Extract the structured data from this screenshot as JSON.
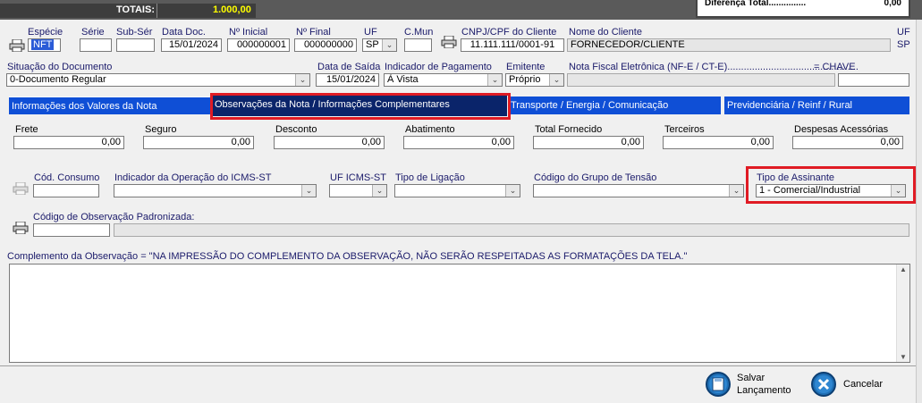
{
  "top": {
    "totais_label": "TOTAIS:",
    "totais_value": "1.000,00",
    "diferenca_label": "Diferença Total...............",
    "diferenca_value": "0,00"
  },
  "header": {
    "especie_label": "Espécie",
    "especie_value": "NFT",
    "serie_label": "Série",
    "serie_value": "",
    "subserie_label": "Sub-Sér",
    "subserie_value": "",
    "datadoc_label": "Data Doc.",
    "datadoc_value": "15/01/2024",
    "ninicial_label": "Nº Inicial",
    "ninicial_value": "000000001",
    "nfinal_label": "Nº Final",
    "nfinal_value": "000000000",
    "uf_label": "UF",
    "uf_value": "SP",
    "cmun_label": "C.Mun",
    "cmun_value": "",
    "cnpj_label": "CNPJ/CPF do Cliente",
    "cnpj_value": "11.111.111/0001-91",
    "nome_label": "Nome do Cliente",
    "nome_value": "FORNECEDOR/CLIENTE",
    "uf2_label": "UF",
    "uf2_value": "SP"
  },
  "row2": {
    "situacao_label": "Situação do Documento",
    "situacao_value": "0-Documento Regular",
    "datasaida_label": "Data de Saída",
    "datasaida_value": "15/01/2024",
    "indpag_label": "Indicador de Pagamento",
    "indpag_value": "À Vista",
    "emitente_label": "Emitente",
    "emitente_value": "Próprio",
    "nfe_label": "Nota Fiscal Eletrônica (NF-E / CT-E)................................................",
    "chave_label": "=  CHAVE",
    "nfe_value": "",
    "chave_value": ""
  },
  "tabs": [
    {
      "label": "Informações dos Valores da Nota"
    },
    {
      "label": "Observações da Nota / Informações Complementares"
    },
    {
      "label": "Transporte / Energia / Comunicação"
    },
    {
      "label": "Previdenciária / Reinf / Rural"
    }
  ],
  "values": [
    {
      "label": "Frete",
      "value": "0,00"
    },
    {
      "label": "Seguro",
      "value": "0,00"
    },
    {
      "label": "Desconto",
      "value": "0,00"
    },
    {
      "label": "Abatimento",
      "value": "0,00"
    },
    {
      "label": "Total Fornecido",
      "value": "0,00"
    },
    {
      "label": "Terceiros",
      "value": "0,00"
    },
    {
      "label": "Despesas Acessórias",
      "value": "0,00"
    }
  ],
  "energy": {
    "codconsumo_label": "Cód. Consumo",
    "codconsumo_value": "",
    "indop_label": "Indicador da Operação do ICMS-ST",
    "indop_value": "",
    "ufst_label": "UF ICMS-ST",
    "ufst_value": "",
    "tipolig_label": "Tipo de Ligação",
    "tipolig_value": "",
    "grupo_label": "Código do Grupo de Tensão",
    "grupo_value": "",
    "assinante_label": "Tipo de Assinante",
    "assinante_value": "1 - Comercial/Industrial"
  },
  "obs": {
    "codobs_label": "Código de Observação Padronizada:",
    "codobs_value": "",
    "codobs_desc": "",
    "complemento_label": "Complemento da Observação = \"NA IMPRESSÃO DO COMPLEMENTO DA OBSERVAÇÃO, NÃO SERÃO RESPEITADAS AS FORMATAÇÕES DA TELA.\"",
    "complemento_value": ""
  },
  "footer": {
    "salvar_label_1": "Salvar",
    "salvar_label_2": "Lançamento",
    "cancelar_label": "Cancelar"
  },
  "colors": {
    "tab_active": "#0a246a",
    "tab_inactive": "#0f4fd6",
    "highlight_red": "#e01b24",
    "totals_yellow": "#ffff00"
  }
}
